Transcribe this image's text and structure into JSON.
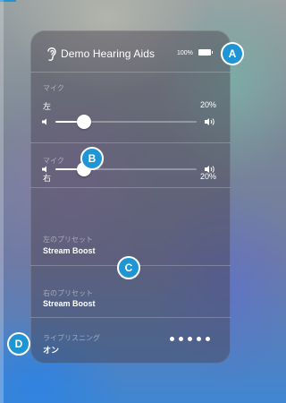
{
  "device": {
    "name": "Demo Hearing Aids",
    "battery": "100%"
  },
  "left": {
    "caption": "マイク",
    "side": "左",
    "percent": "20%",
    "level": 0.2
  },
  "right": {
    "caption": "マイク",
    "side": "右",
    "percent": "20%",
    "level": 0.2
  },
  "left_preset": {
    "caption": "左のプリセット",
    "value": "Stream Boost"
  },
  "right_preset": {
    "caption": "右のプリセット",
    "value": "Stream Boost"
  },
  "live_listen": {
    "caption": "ライブリスニング",
    "value": "オン",
    "dots": 5
  },
  "callouts": {
    "a": "A",
    "b": "B",
    "c": "C",
    "d": "D"
  },
  "colors": {
    "accent": "#1f95d4",
    "panel": "#46414e"
  },
  "icons": [
    "ear-icon",
    "battery-icon",
    "speaker-low-icon",
    "speaker-high-icon"
  ]
}
